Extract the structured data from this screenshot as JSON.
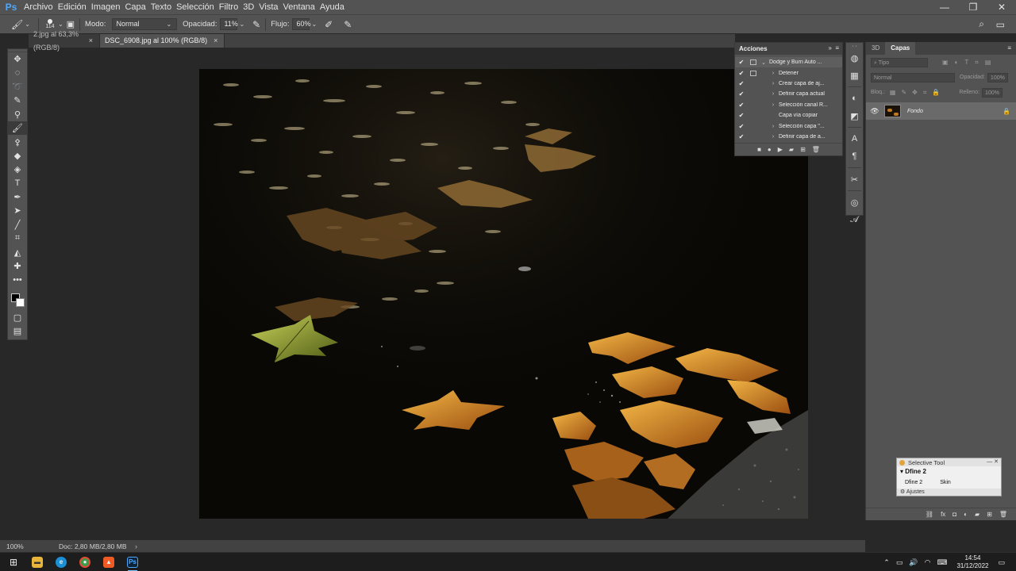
{
  "menubar": {
    "logo": "Ps",
    "items": [
      "Archivo",
      "Edición",
      "Imagen",
      "Capa",
      "Texto",
      "Selección",
      "Filtro",
      "3D",
      "Vista",
      "Ventana",
      "Ayuda"
    ]
  },
  "options": {
    "brush_size": "114",
    "mode_label": "Modo:",
    "mode_value": "Normal",
    "opacity_label": "Opacidad:",
    "opacity_value": "11%",
    "flow_label": "Flujo:",
    "flow_value": "60%"
  },
  "tabs": [
    {
      "label": "2.jpg al 63,3% (RGB/8)",
      "active": false
    },
    {
      "label": "DSC_6908.jpg al 100% (RGB/8)",
      "active": true
    }
  ],
  "status": {
    "zoom": "100%",
    "doc_info": "Doc: 2,80 MB/2,80 MB"
  },
  "actions_panel": {
    "title": "Acciones",
    "rows": [
      {
        "label": "Dodge y Burn Auto ...",
        "has_dialog": true
      },
      {
        "label": "Detener",
        "has_dialog": true
      },
      {
        "label": "Crear capa de aj...",
        "has_dialog": false
      },
      {
        "label": "Definir capa actual",
        "has_dialog": false
      },
      {
        "label": "Selección canal R...",
        "has_dialog": false
      },
      {
        "label": "Capa vía copiar",
        "has_dialog": false
      },
      {
        "label": "Selección capa \"...",
        "has_dialog": false
      },
      {
        "label": "Definir capa de a...",
        "has_dialog": false
      }
    ]
  },
  "layers_panel": {
    "tab_3d": "3D",
    "tab_layers": "Capas",
    "search_placeholder": "Tipo",
    "blend_mode": "Normal",
    "opacity_label": "Opacidad:",
    "opacity_value": "100%",
    "lock_label": "Bloq.:",
    "fill_label": "Relleno:",
    "fill_value": "100%",
    "layer_name": "Fondo"
  },
  "selective_tool": {
    "title": "Selective Tool",
    "plugin": "Dfine 2",
    "col1": "Dfine 2",
    "col2": "Skin",
    "footer": "Ajustes"
  },
  "taskbar": {
    "time": "14:54",
    "date": "31/12/2022"
  },
  "colors": {
    "accent": "#4fa8ff",
    "panel": "#535353",
    "bar": "#424242",
    "workspace": "#282828"
  }
}
